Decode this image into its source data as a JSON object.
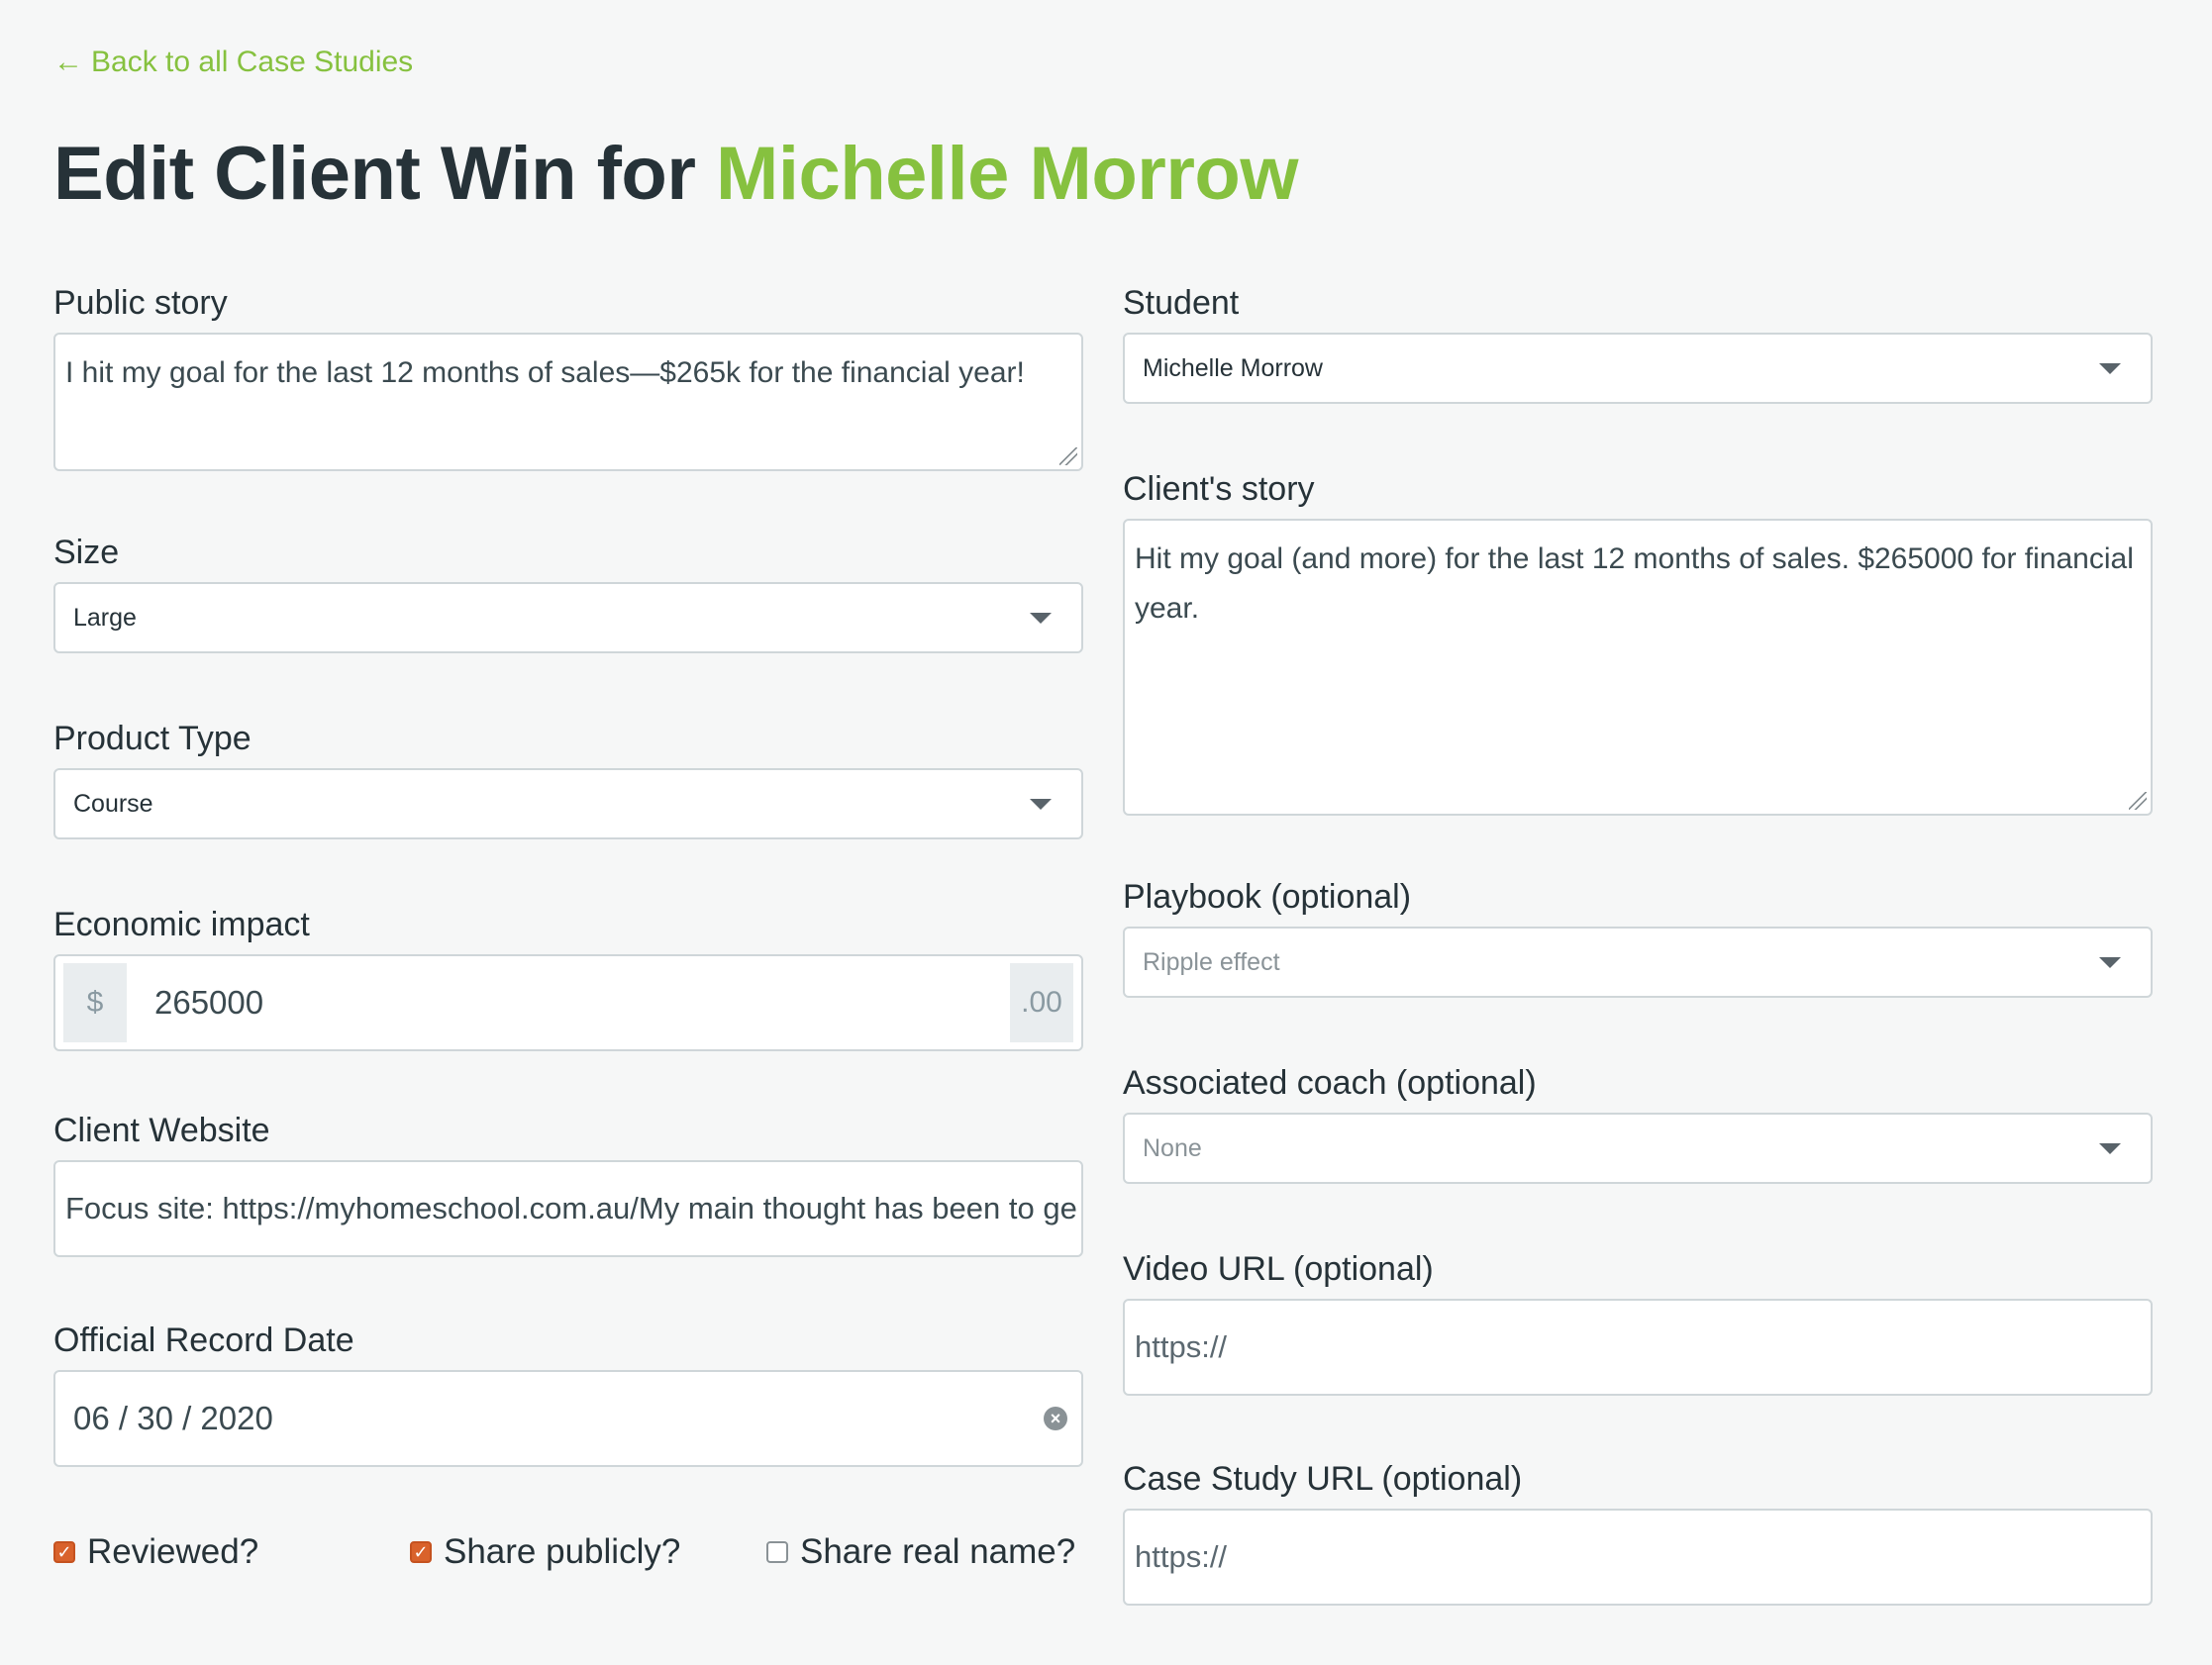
{
  "back_link": {
    "arrow": "←",
    "label": "Back to all Case Studies"
  },
  "title": {
    "prefix": "Edit Client Win for ",
    "name": "Michelle Morrow"
  },
  "left": {
    "public_story": {
      "label": "Public story",
      "value": "I hit my goal for the last 12 months of sales—$265k for the financial year!"
    },
    "size": {
      "label": "Size",
      "value": "Large"
    },
    "product_type": {
      "label": "Product Type",
      "value": "Course"
    },
    "economic_impact": {
      "label": "Economic impact",
      "prefix": "$",
      "value": "265000",
      "suffix": ".00"
    },
    "client_website": {
      "label": "Client Website",
      "value": "Focus site: https://myhomeschool.com.au/My main thought has been to ge"
    },
    "record_date": {
      "label": "Official Record Date",
      "value": "06 / 30 / 2020",
      "clear_icon": "×"
    }
  },
  "checkboxes": [
    {
      "label": "Reviewed?",
      "checked": true
    },
    {
      "label": "Share publicly?",
      "checked": true
    },
    {
      "label": "Share real name?",
      "checked": false
    }
  ],
  "right": {
    "student": {
      "label": "Student",
      "value": "Michelle Morrow"
    },
    "client_story": {
      "label": "Client's story",
      "value": "Hit my goal (and more) for the last 12 months of sales. $265000  for financial year."
    },
    "playbook": {
      "label": "Playbook (optional)",
      "value": "Ripple effect"
    },
    "coach": {
      "label": "Associated coach (optional)",
      "value": "None"
    },
    "video_url": {
      "label": "Video URL (optional)",
      "placeholder": "https://"
    },
    "case_study_url": {
      "label": "Case Study URL (optional)",
      "placeholder": "https://"
    }
  },
  "colors": {
    "accent": "#86c13f",
    "checkbox": "#d9622b",
    "heading": "#263238"
  }
}
